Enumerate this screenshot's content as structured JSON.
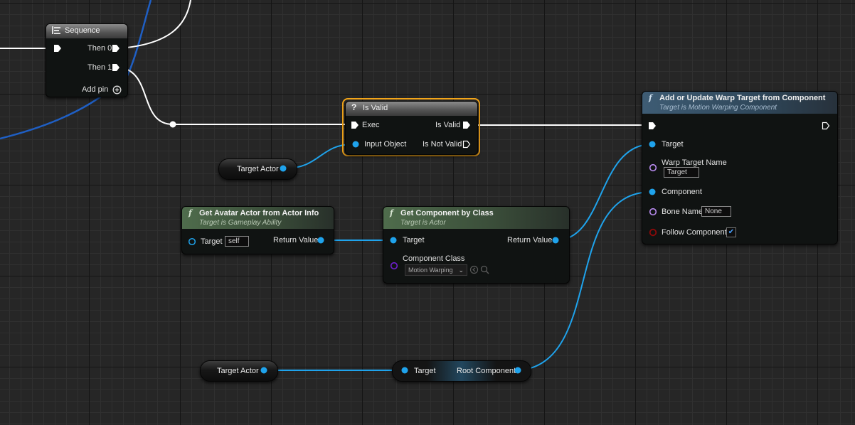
{
  "sequence": {
    "title": "Sequence",
    "then0_label": "Then 0",
    "then1_label": "Then 1",
    "add_pin_label": "Add pin"
  },
  "is_valid": {
    "title": "Is Valid",
    "exec_label": "Exec",
    "input_object_label": "Input Object",
    "is_valid_label": "Is Valid",
    "is_not_valid_label": "Is Not Valid"
  },
  "target_actor_var_1": {
    "label": "Target Actor"
  },
  "target_actor_var_2": {
    "label": "Target Actor"
  },
  "get_avatar_actor": {
    "title": "Get Avatar Actor from Actor Info",
    "subtitle": "Target is Gameplay Ability",
    "target_label": "Target",
    "target_value": "self",
    "return_label": "Return Value"
  },
  "get_component_by_class": {
    "title": "Get Component by Class",
    "subtitle": "Target is Actor",
    "target_label": "Target",
    "return_label": "Return Value",
    "component_class_label": "Component Class",
    "component_class_value": "Motion Warping"
  },
  "root_component": {
    "target_label": "Target",
    "return_label": "Root Component"
  },
  "add_or_update_warp": {
    "title": "Add or Update Warp Target from Component",
    "subtitle": "Target is Motion Warping Component",
    "target_label": "Target",
    "warp_target_name_label": "Warp Target Name",
    "warp_target_name_value": "Target",
    "component_label": "Component",
    "bone_name_label": "Bone Name",
    "bone_name_value": "None",
    "follow_component_label": "Follow Component",
    "follow_component_checked": true
  },
  "colors": {
    "exec": "#ffffff",
    "object_pin": "#1fa3ec",
    "name_pin": "#b98cf0",
    "class_pin": "#6f1fd0",
    "bool_pin": "#8c0a0a",
    "selection": "#f2a51a",
    "object_wire_other": "#1f5fc4"
  }
}
